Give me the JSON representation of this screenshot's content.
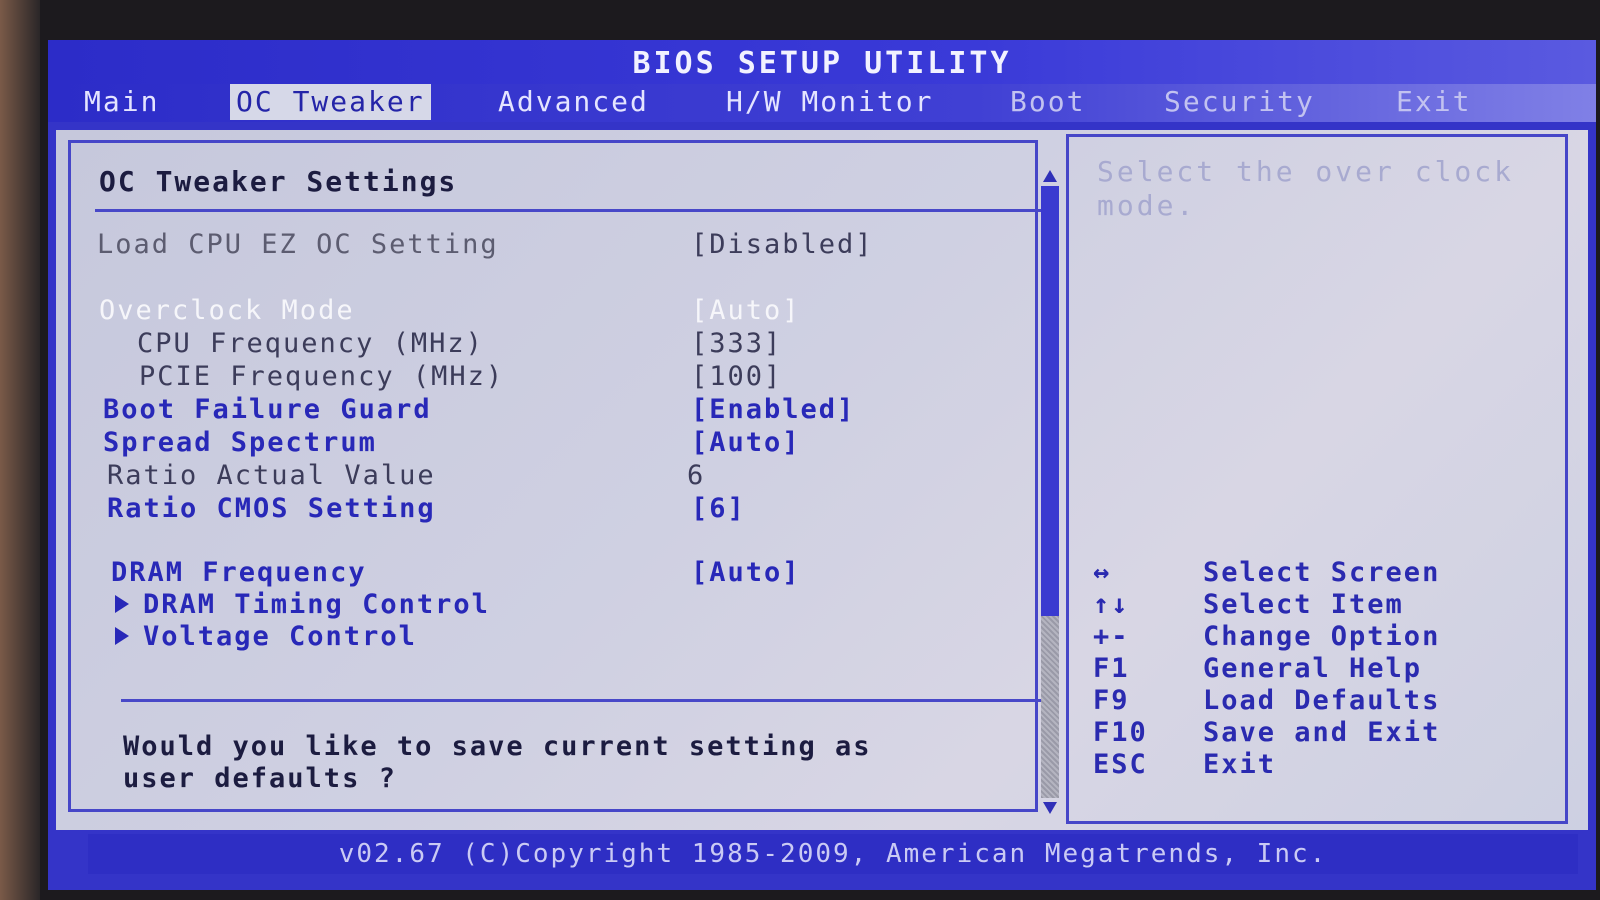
{
  "title": "BIOS SETUP UTILITY",
  "tabs": [
    {
      "label": "Main"
    },
    {
      "label": "OC Tweaker"
    },
    {
      "label": "Advanced"
    },
    {
      "label": "H/W Monitor"
    },
    {
      "label": "Boot"
    },
    {
      "label": "Security"
    },
    {
      "label": "Exit"
    }
  ],
  "section_title": "OC Tweaker Settings",
  "settings": [
    {
      "label": "Load CPU EZ OC Setting",
      "value": "[Disabled]",
      "state": "disabled"
    },
    {
      "label": "Overclock Mode",
      "value": "[Auto]",
      "state": "selected"
    },
    {
      "label": "CPU Frequency (MHz)",
      "value": "[333]",
      "state": "disabled"
    },
    {
      "label": "PCIE Frequency (MHz)",
      "value": "[100]",
      "state": "disabled"
    },
    {
      "label": "Boot Failure Guard",
      "value": "[Enabled]",
      "state": "enabled"
    },
    {
      "label": "Spread Spectrum",
      "value": "[Auto]",
      "state": "enabled"
    },
    {
      "label": "Ratio Actual Value",
      "value": "6",
      "state": "readonly"
    },
    {
      "label": "Ratio CMOS Setting",
      "value": "[6]",
      "state": "enabled"
    },
    {
      "label": "DRAM Frequency",
      "value": "[Auto]",
      "state": "enabled"
    }
  ],
  "submenus": [
    {
      "label": "DRAM Timing Control"
    },
    {
      "label": "Voltage Control"
    }
  ],
  "question": "Would you like to save current setting as user defaults ?",
  "help_text": "Select the over clock mode.",
  "keys": [
    {
      "key": "↔",
      "desc": "Select Screen"
    },
    {
      "key": "↑↓",
      "desc": "Select Item"
    },
    {
      "key": "+-",
      "desc": "Change Option"
    },
    {
      "key": "F1",
      "desc": "General Help"
    },
    {
      "key": "F9",
      "desc": "Load Defaults"
    },
    {
      "key": "F10",
      "desc": "Save and Exit"
    },
    {
      "key": "ESC",
      "desc": "Exit"
    }
  ],
  "footer": "v02.67 (C)Copyright 1985-2009, American Megatrends, Inc.",
  "colors": {
    "accent_blue": "#2828b8",
    "screen_blue": "#3434c8",
    "panel_grey": "#cfd0e2",
    "highlight_white": "#f6f6fa"
  }
}
